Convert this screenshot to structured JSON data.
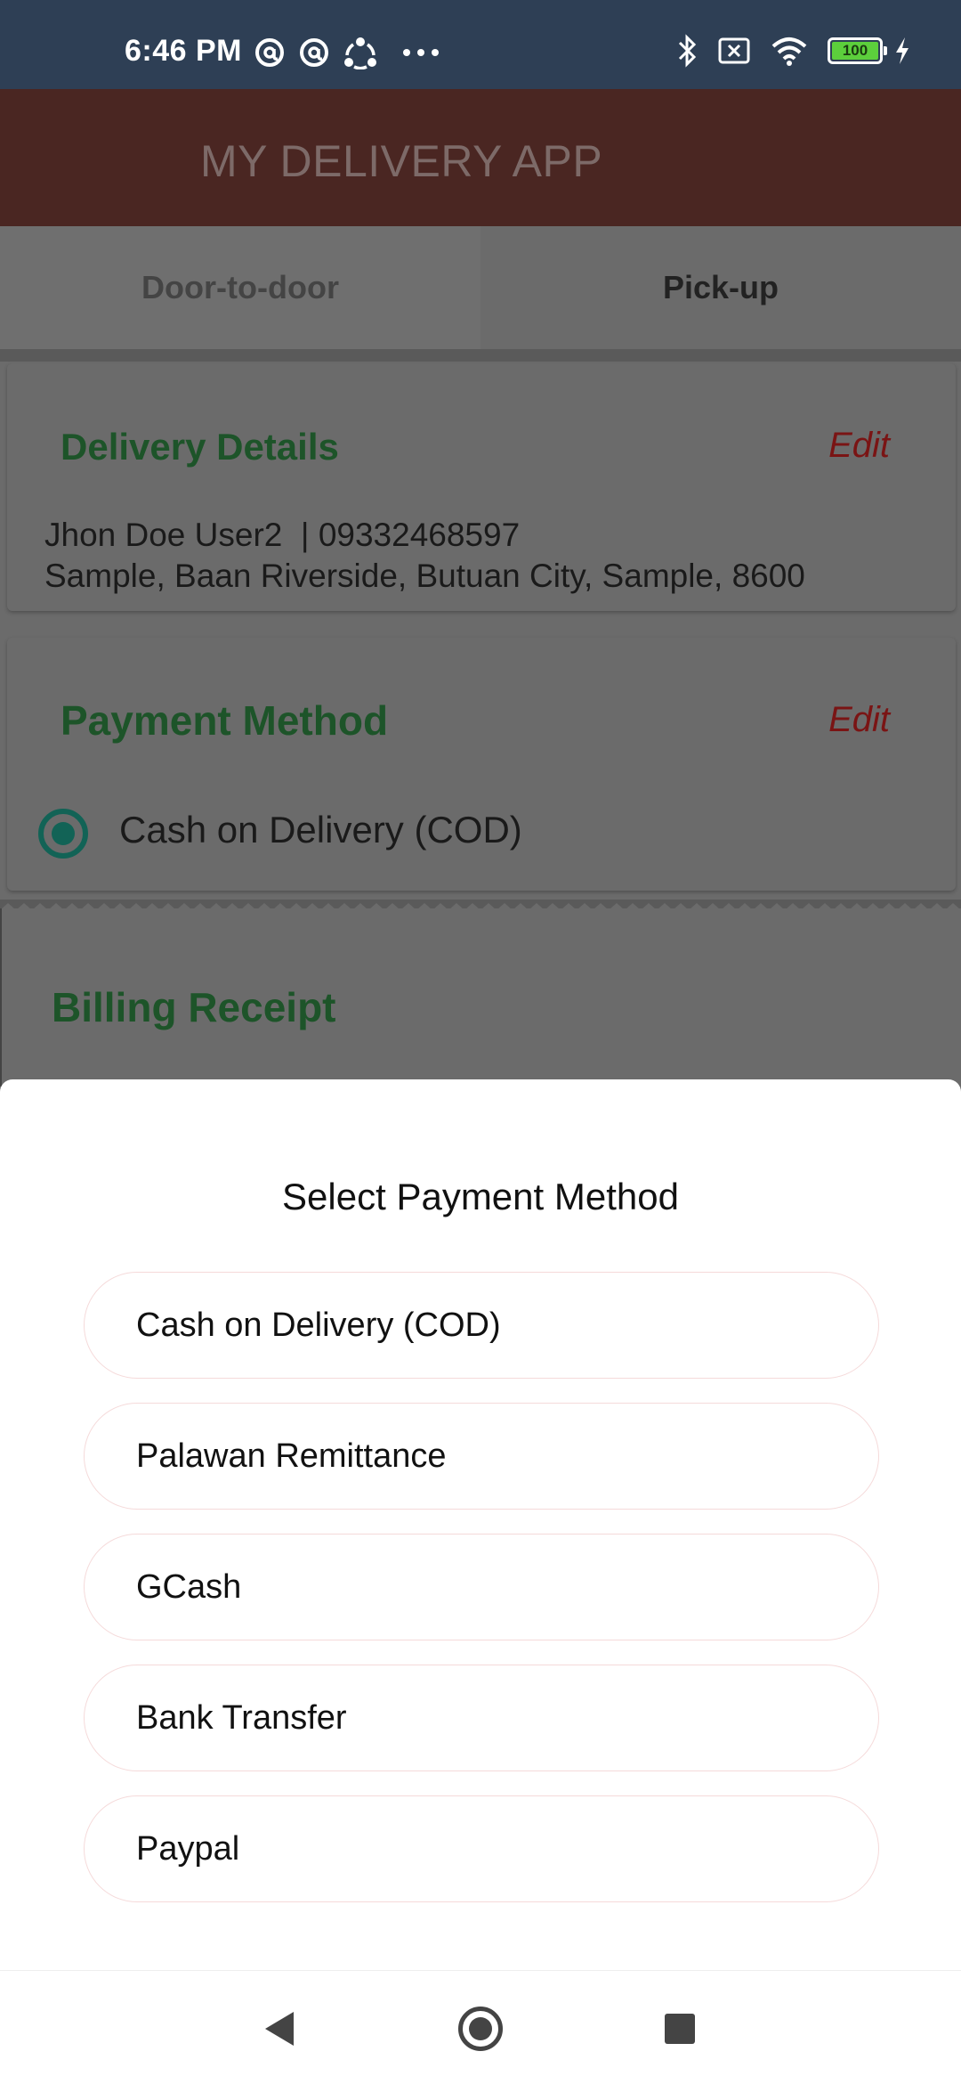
{
  "status_bar": {
    "time": "6:46 PM",
    "left_icons": [
      "at-sign-icon",
      "at-sign-icon",
      "share-nodes-icon",
      "more-dots-icon"
    ],
    "right_icons": [
      "bluetooth-icon",
      "no-sim-icon",
      "wifi-icon",
      "battery-icon",
      "charging-bolt-icon"
    ],
    "battery_level": "100"
  },
  "app_bar": {
    "title": "MY DELIVERY APP"
  },
  "tabs": [
    {
      "label": "Door-to-door"
    },
    {
      "label": "Pick-up"
    }
  ],
  "delivery_details": {
    "title": "Delivery Details",
    "edit_label": "Edit",
    "name_phone": "Jhon Doe User2  | 09332468597",
    "address": "Sample, Baan Riverside, Butuan City, Sample, 8600"
  },
  "payment_method": {
    "title": "Payment Method",
    "edit_label": "Edit",
    "selected": "Cash on Delivery (COD)"
  },
  "billing_receipt": {
    "title": "Billing Receipt"
  },
  "sheet": {
    "title": "Select Payment Method",
    "options": [
      "Cash on Delivery (COD)",
      "Palawan Remittance",
      "GCash",
      "Bank Transfer",
      "Paypal"
    ]
  },
  "colors": {
    "status_bar": "#2e3f55",
    "app_bar_dimmed": "#4a2622",
    "section_title_green": "#1d5429",
    "edit_red": "#7a1414",
    "radio_teal": "#126356",
    "battery_green": "#5ccf3c"
  }
}
